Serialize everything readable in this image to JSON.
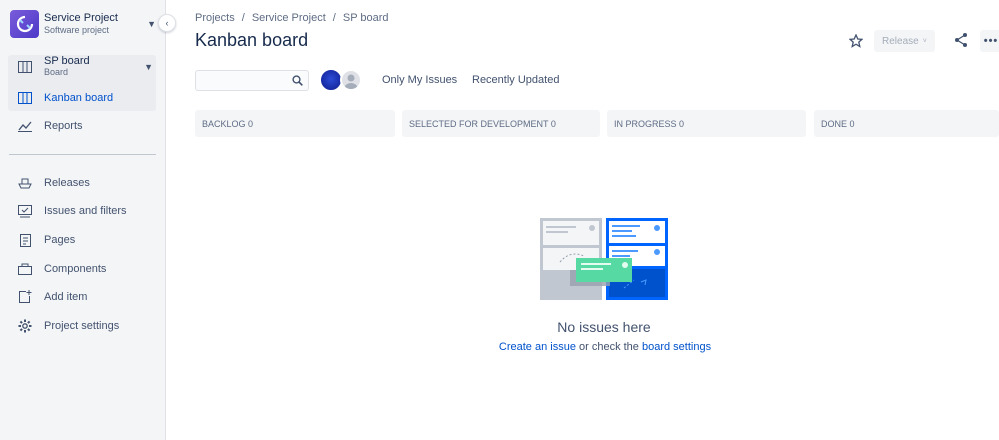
{
  "sidebar": {
    "project_name": "Service Project",
    "project_type": "Software project",
    "board_name": "SP board",
    "board_type": "Board",
    "items": [
      {
        "label": "Kanban board"
      },
      {
        "label": "Reports"
      },
      {
        "label": "Releases"
      },
      {
        "label": "Issues and filters"
      },
      {
        "label": "Pages"
      },
      {
        "label": "Components"
      },
      {
        "label": "Add item"
      },
      {
        "label": "Project settings"
      }
    ]
  },
  "breadcrumbs": [
    "Projects",
    "Service Project",
    "SP board"
  ],
  "breadcrumb_sep": "/",
  "page_title": "Kanban board",
  "toolbar": {
    "release_label": "Release"
  },
  "filters": {
    "search_placeholder": "",
    "only_my_issues": "Only My Issues",
    "recently_updated": "Recently Updated"
  },
  "columns": [
    {
      "label": "Backlog 0"
    },
    {
      "label": "Selected for Development 0"
    },
    {
      "label": "In Progress 0"
    },
    {
      "label": "Done 0"
    }
  ],
  "empty": {
    "title": "No issues here",
    "create_link": "Create an issue",
    "middle_text": " or check the ",
    "settings_link": "board settings"
  },
  "colors": {
    "accent": "#0052cc",
    "sidebar_bg": "#f4f5f7",
    "column_bg": "#f4f5f7"
  }
}
